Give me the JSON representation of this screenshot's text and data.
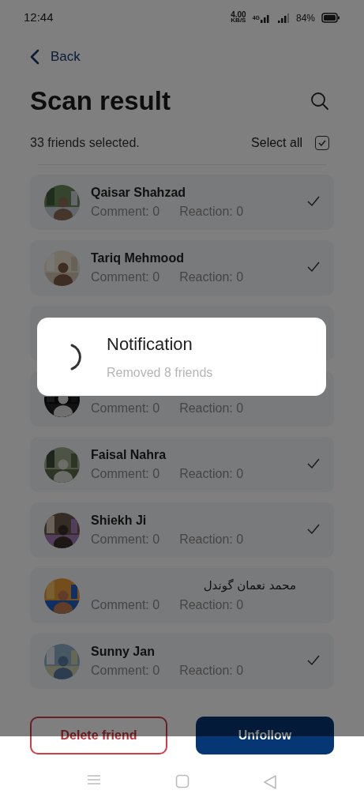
{
  "status_bar": {
    "time": "12:44",
    "speed": "4.00",
    "speed_unit": "KB/S",
    "network": "4G",
    "battery": "84%"
  },
  "back": {
    "label": "Back"
  },
  "title": "Scan result",
  "summary": "33 friends selected.",
  "select_all": {
    "label": "Select all",
    "checked": true
  },
  "friends": [
    {
      "name": "Qaisar Shahzad",
      "comment": "Comment: 0",
      "reaction": "Reaction: 0",
      "checked": true
    },
    {
      "name": "Tariq Mehmood",
      "comment": "Comment: 0",
      "reaction": "Reaction: 0",
      "checked": true
    },
    {
      "comment": "Comment: 0",
      "reaction": "Reaction: 0"
    },
    {
      "name": "Faisal Nahra",
      "comment": "Comment: 0",
      "reaction": "Reaction: 0",
      "checked": true
    },
    {
      "name": "Shiekh Ji",
      "comment": "Comment: 0",
      "reaction": "Reaction: 0",
      "checked": true
    },
    {
      "name": "محمد نعمان گوندل",
      "comment": "Comment: 0",
      "reaction": "Reaction: 0",
      "checked": false
    },
    {
      "name": "Sunny Jan",
      "comment": "Comment: 0",
      "reaction": "Reaction: 0",
      "checked": true
    }
  ],
  "notification": {
    "title": "Notification",
    "message": "Removed 8 friends"
  },
  "buttons": [
    {
      "label": "Delete friend",
      "kind": "outline"
    },
    {
      "label": "Unfollow",
      "kind": "filled"
    }
  ]
}
